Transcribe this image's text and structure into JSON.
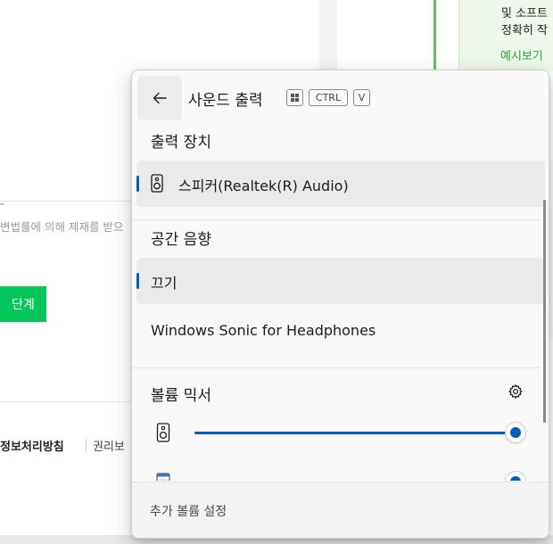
{
  "background": {
    "right_panel_lines": [
      "및 소프트",
      "정확히 작"
    ],
    "right_panel_link": "예시보기",
    "doc_text": "변법률에 의해 제재를 받으",
    "green_button": "단계",
    "footer_privacy": "정보처리방침",
    "footer_rights": "권리보"
  },
  "flyout": {
    "title": "사운드 출력",
    "shortcut": {
      "win_key_icon": "windows-key-icon",
      "ctrl": "CTRL",
      "v": "V"
    },
    "output_devices": {
      "title": "출력 장치",
      "items": [
        {
          "label": "스피커(Realtek(R) Audio)",
          "icon": "speaker-icon",
          "selected": true
        }
      ]
    },
    "spatial_sound": {
      "title": "공간 음향",
      "items": [
        {
          "label": "끄기",
          "selected": true
        },
        {
          "label": "Windows Sonic for Headphones",
          "selected": false
        }
      ]
    },
    "volume_mixer": {
      "title": "볼륨 믹서",
      "settings_icon": "gear-icon",
      "sliders": [
        {
          "icon": "speaker-icon",
          "value": 100
        },
        {
          "icon": "app-window-icon",
          "value": 100
        }
      ]
    },
    "footer_link": "추가 볼륨 설정"
  },
  "colors": {
    "accent": "#005fb8",
    "flyout_bg": "#f9f9f9",
    "selected_row": "#eaeaea",
    "naver_green": "#03c75a"
  }
}
